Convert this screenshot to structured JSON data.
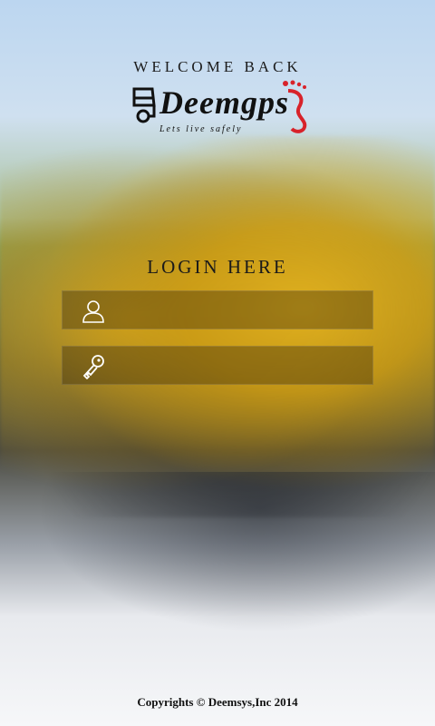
{
  "header": {
    "welcome_text": "WELCOME BACK",
    "brand_name": "Deemgps",
    "tagline": "Lets live safely"
  },
  "login": {
    "title": "LOGIN HERE",
    "username_placeholder": "",
    "password_placeholder": ""
  },
  "footer": {
    "copyright": "Copyrights © Deemsys,Inc 2014"
  },
  "colors": {
    "text_dark": "#111111",
    "field_bg": "rgba(40,30,10,0.35)",
    "accent_red": "#d8222a"
  },
  "icons": {
    "username": "user-icon",
    "password": "key-icon"
  }
}
